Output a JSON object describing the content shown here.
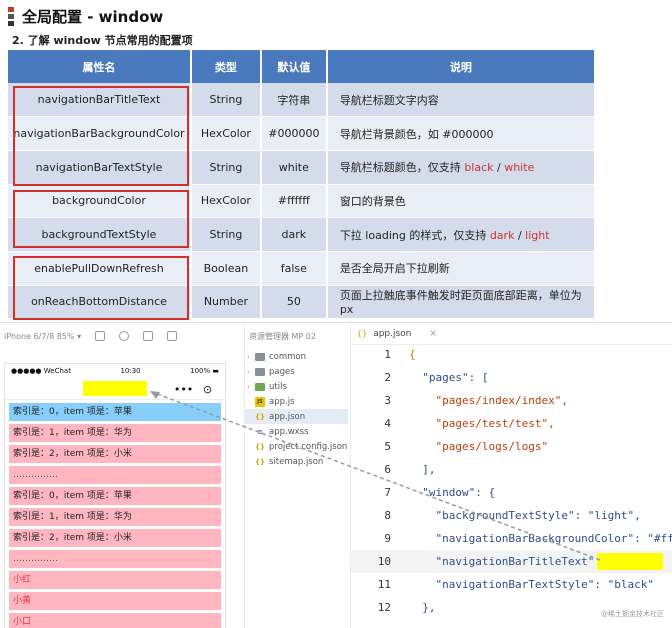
{
  "slide": {
    "title": "全局配置 - window",
    "subtitle": "2. 了解 window 节点常用的配置项",
    "headers": [
      "属性名",
      "类型",
      "默认值",
      "说明"
    ],
    "rows": [
      {
        "name": "navigationBarTitleText",
        "type": "String",
        "default": "字符串",
        "desc": "导航栏标题文字内容"
      },
      {
        "name": "navigationBarBackgroundColor",
        "type": "HexColor",
        "default": "#000000",
        "desc": "导航栏背景颜色，如 #000000"
      },
      {
        "name": "navigationBarTextStyle",
        "type": "String",
        "default": "white",
        "desc_pre": "导航栏标题颜色，仅支持 ",
        "desc_a": "black",
        "desc_sep": " / ",
        "desc_b": "white"
      },
      {
        "name": "backgroundColor",
        "type": "HexColor",
        "default": "#ffffff",
        "desc": "窗口的背景色"
      },
      {
        "name": "backgroundTextStyle",
        "type": "String",
        "default": "dark",
        "desc_pre": "下拉 loading 的样式，仅支持 ",
        "desc_a": "dark",
        "desc_sep": " / ",
        "desc_b": "light"
      },
      {
        "name": "enablePullDownRefresh",
        "type": "Boolean",
        "default": "false",
        "desc": "是否全局开启下拉刷新"
      },
      {
        "name": "onReachBottomDistance",
        "type": "Number",
        "default": "50",
        "desc": "页面上拉触底事件触发时距页面底部距离，单位为px"
      }
    ],
    "colors": {
      "header_bg": "#4b79bd",
      "row_odd": "#d4dcec",
      "row_even": "#e9eef6",
      "highlight_red": "#d0312d"
    }
  },
  "simulator": {
    "toolbar_label": "iPhone 6/7/8 85% ▾",
    "status_left": "●●●●● WeChat",
    "status_time": "10:30",
    "status_right": "100% ▬",
    "capsule_dots": "•••",
    "capsule_circle": "⊙",
    "list": [
      "索引是：0，item 项是：苹果",
      "索引是：1，item 项是：华为",
      "索引是：2，item 项是：小米",
      "……………",
      "索引是：0，item 项是：苹果",
      "索引是：1，item 项是：华为",
      "索引是：2，item 项是：小米",
      "……………",
      "小红",
      "小黄",
      "小口"
    ]
  },
  "explorer": {
    "header": "资源管理器  MP 02",
    "items": [
      {
        "label": "common",
        "kind": "folder"
      },
      {
        "label": "pages",
        "kind": "folder"
      },
      {
        "label": "utils",
        "kind": "folder-green"
      },
      {
        "label": "app.js",
        "kind": "js"
      },
      {
        "label": "app.json",
        "kind": "json"
      },
      {
        "label": "app.wxss",
        "kind": "css"
      },
      {
        "label": "project.config.json",
        "kind": "json"
      },
      {
        "label": "sitemap.json",
        "kind": "json"
      }
    ]
  },
  "editor": {
    "tab_label": "app.json",
    "lines": [
      {
        "n": "1",
        "text": "{"
      },
      {
        "n": "2",
        "text": "  \"pages\": ["
      },
      {
        "n": "3",
        "text": "    \"pages/index/index\","
      },
      {
        "n": "4",
        "text": "    \"pages/test/test\","
      },
      {
        "n": "5",
        "text": "    \"pages/logs/logs\""
      },
      {
        "n": "6",
        "text": "  ],"
      },
      {
        "n": "7",
        "text": "  \"window\": {"
      },
      {
        "n": "8",
        "text": "    \"backgroundTextStyle\": \"light\","
      },
      {
        "n": "9",
        "text": "    \"navigationBarBackgroundColor\": \"#fff\","
      },
      {
        "n": "10",
        "text": "    \"navigationBarTitleText\": \""
      },
      {
        "n": "11",
        "text": "    \"navigationBarTextStyle\": \"black\""
      },
      {
        "n": "12",
        "text": "  },"
      }
    ],
    "watermark": "@稀土掘金技术社区"
  }
}
